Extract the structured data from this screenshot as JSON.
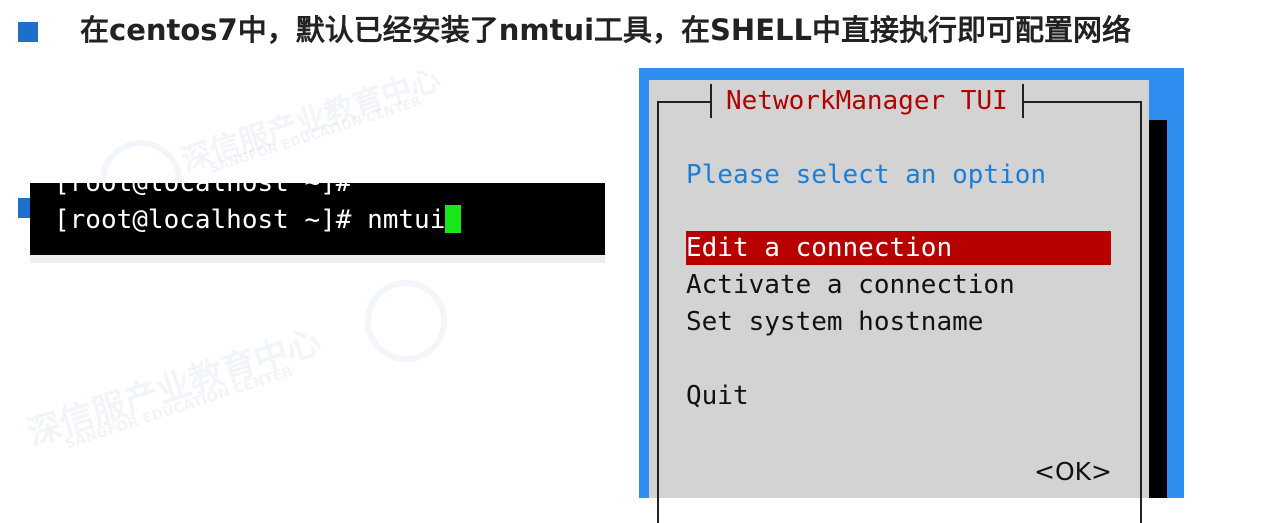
{
  "heading": {
    "text": "在centos7中，默认已经安装了nmtui工具，在SHELL中直接执行即可配置网络"
  },
  "terminal": {
    "previous_line": "[root@localhost ~]#",
    "prompt": "[root@localhost ~]# ",
    "command": "nmtui"
  },
  "tui": {
    "title": "NetworkManager TUI",
    "prompt": "Please select an option",
    "menu": [
      {
        "label": "Edit a connection",
        "selected": true
      },
      {
        "label": "Activate a connection",
        "selected": false
      },
      {
        "label": "Set system hostname",
        "selected": false
      },
      {
        "label": "Quit",
        "selected": false
      }
    ],
    "ok_label": "<OK>"
  },
  "colors": {
    "bullet": "#1e6fc9",
    "tui_background": "#2f8ff0",
    "dialog": "#d3d3d3",
    "title_text": "#b00000",
    "prompt_text": "#1a7fd8",
    "selection": "#b80000",
    "cursor": "#19e619"
  },
  "watermark": {
    "text": "深信服产业教育中心",
    "subtext": "SANGFOR EDUCATION CENTER"
  }
}
